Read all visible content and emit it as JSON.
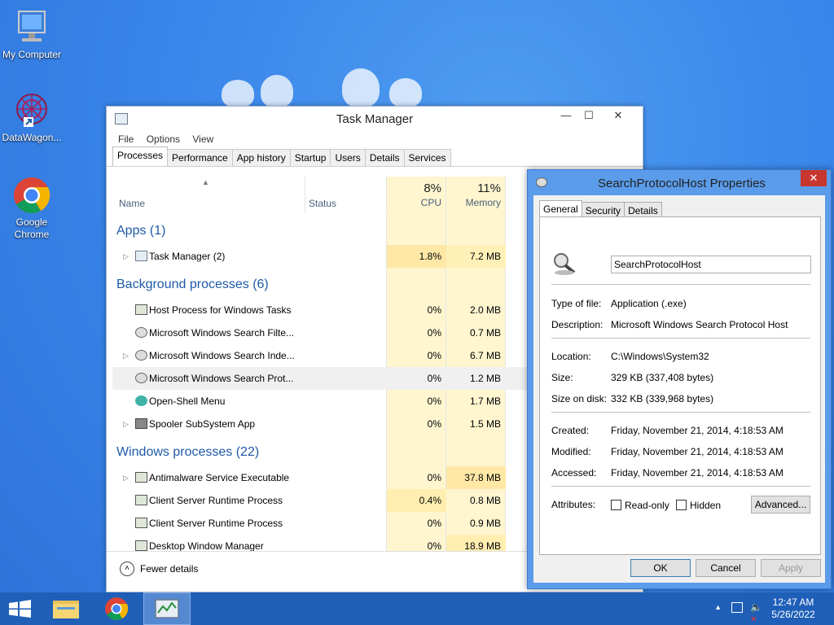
{
  "desktop": {
    "icons": [
      {
        "label": "My Computer",
        "icon": "computer-icon"
      },
      {
        "label": "DataWagon...",
        "icon": "datawagon-shortcut-icon"
      },
      {
        "label": "Google Chrome",
        "icon": "chrome-icon"
      }
    ]
  },
  "task_manager": {
    "title": "Task Manager",
    "menu": [
      "File",
      "Options",
      "View"
    ],
    "tabs": [
      "Processes",
      "Performance",
      "App history",
      "Startup",
      "Users",
      "Details",
      "Services"
    ],
    "active_tab": "Processes",
    "columns": {
      "name": "Name",
      "status": "Status",
      "cpu_pct": "8%",
      "cpu": "CPU",
      "memory_pct": "11%",
      "memory": "Memory"
    },
    "groups": [
      {
        "name": "Apps (1)",
        "rows": [
          {
            "name": "Task Manager (2)",
            "cpu": "1.8%",
            "mem": "7.2 MB",
            "expandable": true
          }
        ]
      },
      {
        "name": "Background processes (6)",
        "rows": [
          {
            "name": "Host Process for Windows Tasks",
            "cpu": "0%",
            "mem": "2.0 MB",
            "expandable": false
          },
          {
            "name": "Microsoft Windows Search Filte...",
            "cpu": "0%",
            "mem": "0.7 MB",
            "expandable": false
          },
          {
            "name": "Microsoft Windows Search Inde...",
            "cpu": "0%",
            "mem": "6.7 MB",
            "expandable": true
          },
          {
            "name": "Microsoft Windows Search Prot...",
            "cpu": "0%",
            "mem": "1.2 MB",
            "expandable": false,
            "selected": true
          },
          {
            "name": "Open-Shell Menu",
            "cpu": "0%",
            "mem": "1.7 MB",
            "expandable": false
          },
          {
            "name": "Spooler SubSystem App",
            "cpu": "0%",
            "mem": "1.5 MB",
            "expandable": true
          }
        ]
      },
      {
        "name": "Windows processes (22)",
        "rows": [
          {
            "name": "Antimalware Service Executable",
            "cpu": "0%",
            "mem": "37.8 MB",
            "expandable": true
          },
          {
            "name": "Client Server Runtime Process",
            "cpu": "0.4%",
            "mem": "0.8 MB",
            "expandable": false
          },
          {
            "name": "Client Server Runtime Process",
            "cpu": "0%",
            "mem": "0.9 MB",
            "expandable": false
          },
          {
            "name": "Desktop Window Manager",
            "cpu": "0%",
            "mem": "18.9 MB",
            "expandable": false
          }
        ]
      }
    ],
    "fewer_details": "Fewer details"
  },
  "properties": {
    "title": "SearchProtocolHost Properties",
    "tabs": [
      "General",
      "Security",
      "Details"
    ],
    "file_name": "SearchProtocolHost",
    "type_label": "Type of file:",
    "type_value": "Application (.exe)",
    "desc_label": "Description:",
    "desc_value": "Microsoft Windows Search Protocol Host",
    "location_label": "Location:",
    "location_value": "C:\\Windows\\System32",
    "size_label": "Size:",
    "size_value": "329 KB (337,408 bytes)",
    "size_disk_label": "Size on disk:",
    "size_disk_value": "332 KB (339,968 bytes)",
    "created_label": "Created:",
    "created_value": "Friday, November 21, 2014, 4:18:53 AM",
    "modified_label": "Modified:",
    "modified_value": "Friday, November 21, 2014, 4:18:53 AM",
    "accessed_label": "Accessed:",
    "accessed_value": "Friday, November 21, 2014, 4:18:53 AM",
    "attributes_label": "Attributes:",
    "readonly_label": "Read-only",
    "hidden_label": "Hidden",
    "advanced_label": "Advanced...",
    "ok_label": "OK",
    "cancel_label": "Cancel",
    "apply_label": "Apply"
  },
  "taskbar": {
    "time": "12:47 AM",
    "date": "5/26/2022"
  }
}
